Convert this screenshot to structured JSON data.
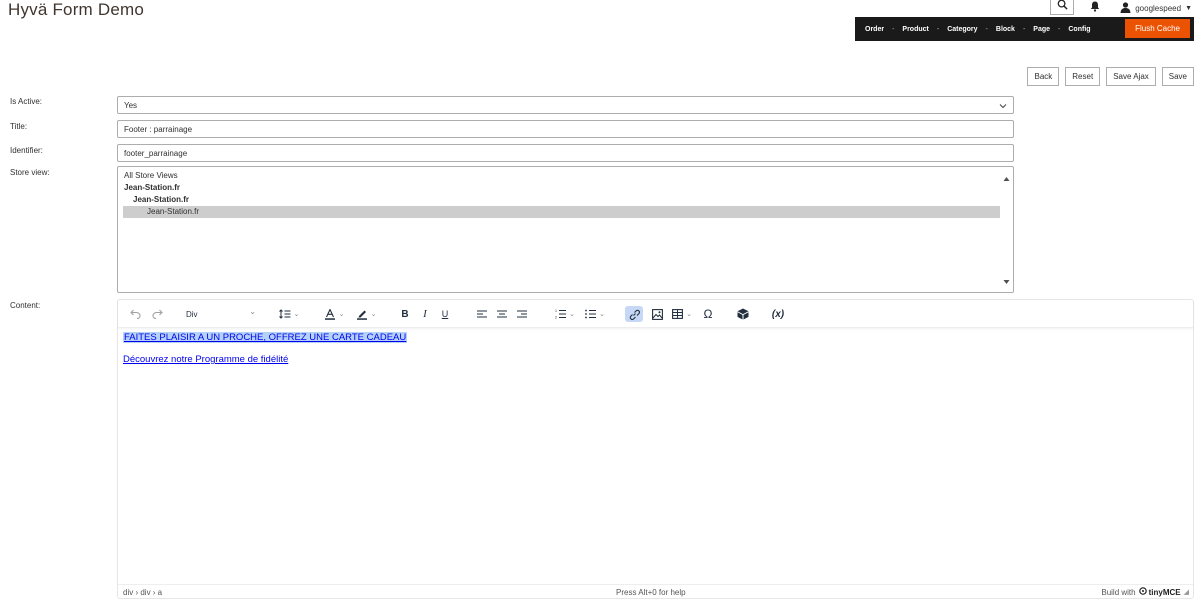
{
  "header": {
    "title": "Hyvä Form Demo",
    "username": "googlespeed"
  },
  "admin_bar": {
    "items": [
      "Order",
      "Product",
      "Category",
      "Block",
      "Page",
      "Config"
    ],
    "flush_label": "Flush Cache",
    "accent_color": "#eb5202"
  },
  "form_buttons": {
    "back": "Back",
    "reset": "Reset",
    "save_ajax": "Save Ajax",
    "save": "Save"
  },
  "form": {
    "is_active": {
      "label": "Is Active:",
      "value": "Yes"
    },
    "title": {
      "label": "Title:",
      "value": "Footer : parrainage"
    },
    "identifier": {
      "label": "Identifier:",
      "value": "footer_parrainage"
    },
    "store_view": {
      "label": "Store view:",
      "options": [
        "All Store Views",
        "Jean-Station.fr",
        "Jean-Station.fr",
        "Jean-Station.fr"
      ],
      "selected": "Jean-Station.fr"
    },
    "content_label": "Content:"
  },
  "editor": {
    "block_format": "Div",
    "lines": [
      "FAITES PLAISIR A UN PROCHE, OFFREZ UNE CARTE CADEAU",
      "Découvrez notre Programme de fidélité"
    ],
    "status_path": "div › div › a",
    "help": "Press Alt+0 for help",
    "built_with": "Build with",
    "brand": "tinyMCE"
  }
}
